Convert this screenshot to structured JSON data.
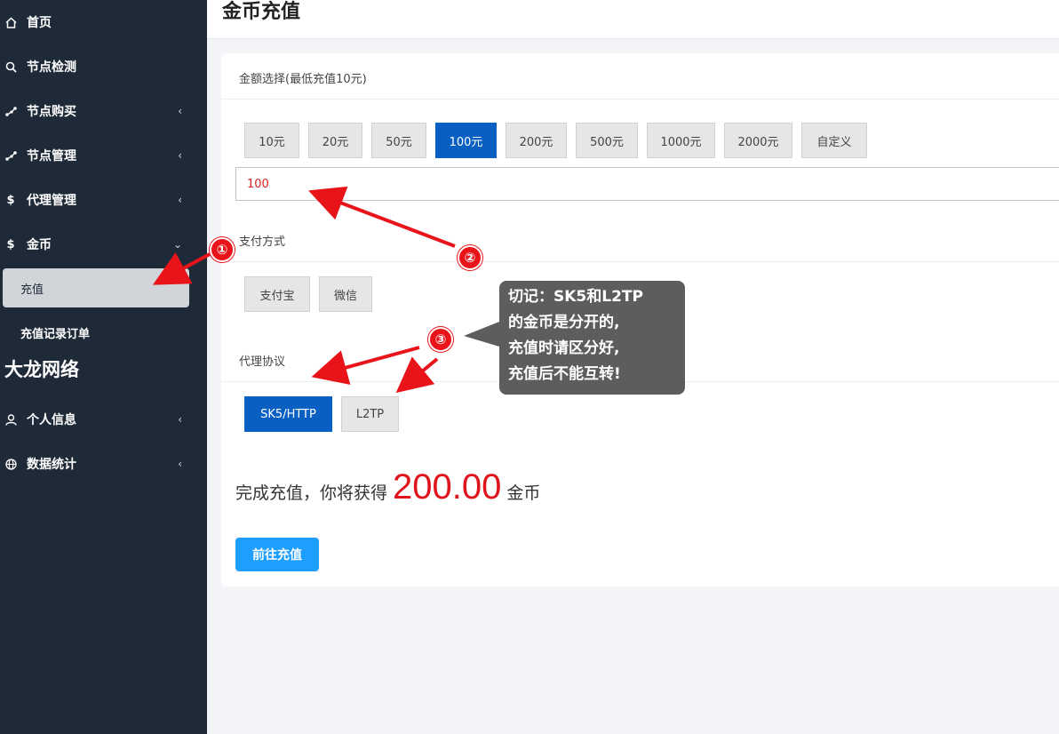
{
  "sidebar": {
    "items": [
      {
        "label": "首页",
        "icon": "home-icon"
      },
      {
        "label": "节点检测",
        "icon": "search-icon"
      },
      {
        "label": "节点购买",
        "icon": "share-icon"
      },
      {
        "label": "节点管理",
        "icon": "share-icon"
      },
      {
        "label": "代理管理",
        "icon": "dollar-icon"
      },
      {
        "label": "金币",
        "icon": "dollar-icon"
      },
      {
        "label": "个人信息",
        "icon": "user-icon"
      },
      {
        "label": "数据统计",
        "icon": "globe-icon"
      }
    ],
    "sub_items": [
      "充值",
      "充值记录订单"
    ],
    "watermark": "大龙网络"
  },
  "header": {
    "title": "金币充值"
  },
  "amount": {
    "label": "金额选择(最低充值10元)",
    "options": [
      "10元",
      "20元",
      "50元",
      "100元",
      "200元",
      "500元",
      "1000元",
      "2000元",
      "自定义"
    ],
    "selected_index": 3,
    "input_value": "100"
  },
  "payment": {
    "label": "支付方式",
    "options": [
      "支付宝",
      "微信"
    ]
  },
  "protocol": {
    "label": "代理协议",
    "options": [
      "SK5/HTTP",
      "L2TP"
    ],
    "selected_index": 0
  },
  "result": {
    "prefix": "完成充值，你将获得",
    "amount": "200.00",
    "suffix": "金币"
  },
  "submit_label": "前往充值",
  "annotations": {
    "markers": [
      "①",
      "②",
      "③"
    ],
    "bubble_lines": [
      "切记：SK5和L2TP",
      "的金币是分开的,",
      "充值时请区分好,",
      "充值后不能互转!"
    ],
    "color": "#e8141a"
  },
  "colors": {
    "sidebar_bg": "#1f2a38",
    "primary": "#0a60c2",
    "submit": "#1e9fff",
    "highlight": "#e0141c"
  }
}
